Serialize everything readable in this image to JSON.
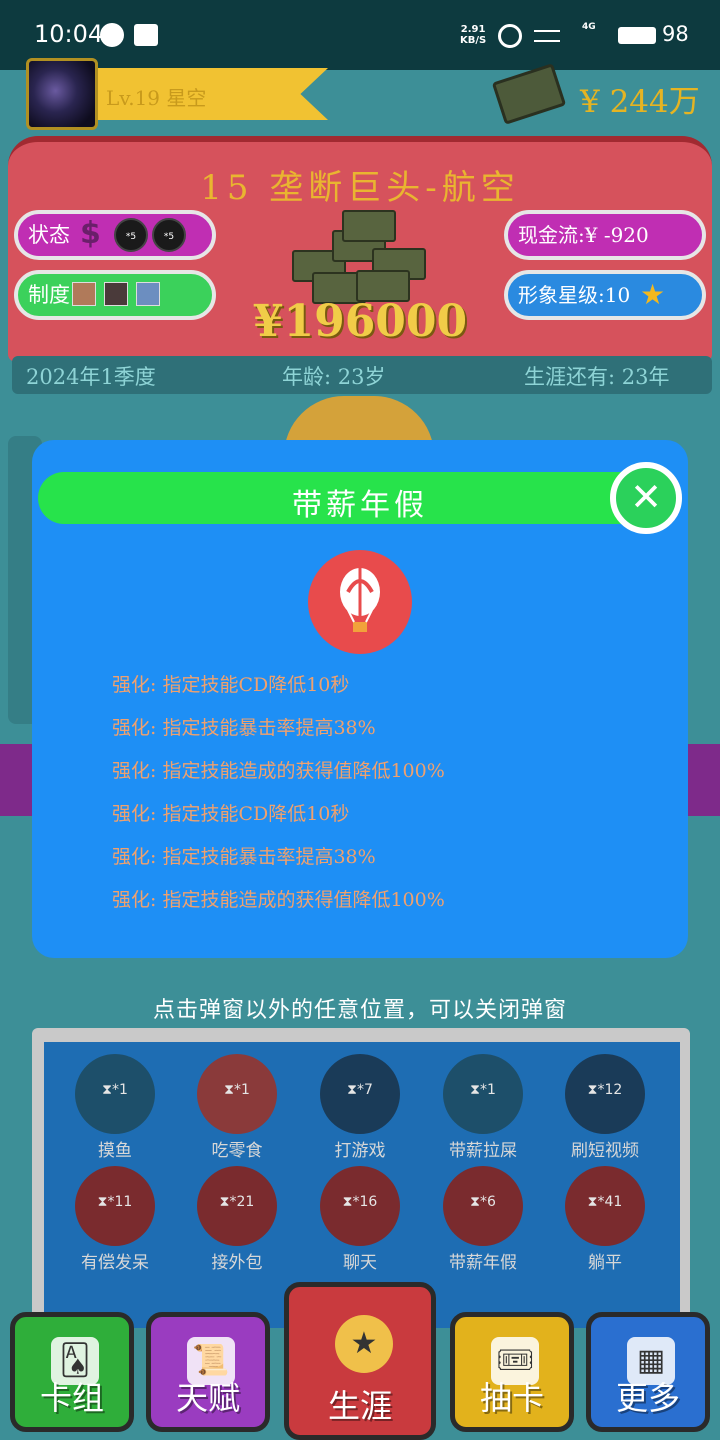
{
  "status_bar": {
    "time": "10:04",
    "speed_top": "2.91",
    "speed_bottom": "KB/S",
    "network": "4G",
    "battery": "98"
  },
  "header": {
    "level": "Lv.19 星空",
    "cash": "¥ 244万"
  },
  "company": {
    "title": "15 垄断巨头-航空",
    "status_label": "状态",
    "status_badges": [
      "*5",
      "*5"
    ],
    "system_label": "制度",
    "cash_flow": "现金流:¥ -920",
    "image_star": "形象星级:10",
    "amount": "¥196000",
    "date": "2024年1季度",
    "age": "年龄: 23岁",
    "career_left": "生涯还有: 23年"
  },
  "modal": {
    "title": "带薪年假",
    "effects": [
      "强化: 指定技能CD降低10秒",
      "强化: 指定技能暴击率提高38%",
      "强化: 指定技能造成的获得值降低100%",
      "强化: 指定技能CD降低10秒",
      "强化: 指定技能暴击率提高38%",
      "强化: 指定技能造成的获得值降低100%"
    ]
  },
  "hint": "点击弹窗以外的任意位置，可以关闭弹窗",
  "skills": [
    {
      "name": "摸鱼",
      "count": "⧗*1",
      "color": "#1d4f6a",
      "icon": "fish-icon"
    },
    {
      "name": "吃零食",
      "count": "⧗*1",
      "color": "#8a3a3a",
      "icon": "snack-icon"
    },
    {
      "name": "打游戏",
      "count": "⧗*7",
      "color": "#1a3b58",
      "icon": "gamepad-icon"
    },
    {
      "name": "带薪拉屎",
      "count": "⧗*1",
      "color": "#1d4f6a",
      "icon": "toilet-paper-icon"
    },
    {
      "name": "刷短视频",
      "count": "⧗*12",
      "color": "#1a3b58",
      "icon": "phone-icon"
    },
    {
      "name": "有偿发呆",
      "count": "⧗*11",
      "color": "#7a2b2e",
      "icon": "daydream-icon"
    },
    {
      "name": "接外包",
      "count": "⧗*21",
      "color": "#7a2b2e",
      "icon": "laptop-icon"
    },
    {
      "name": "聊天",
      "count": "⧗*16",
      "color": "#7a2b2e",
      "icon": "chat-icon"
    },
    {
      "name": "带薪年假",
      "count": "⧗*6",
      "color": "#7a2b2e",
      "icon": "balloon-icon"
    },
    {
      "name": "躺平",
      "count": "⧗*41",
      "color": "#7a2b2e",
      "icon": "lie-flat-icon"
    }
  ],
  "tabs": [
    {
      "label": "卡组",
      "color": "#2fae3a",
      "icon": "cards-icon",
      "glyph": "🂡"
    },
    {
      "label": "天赋",
      "color": "#9a3cc0",
      "icon": "scroll-icon",
      "glyph": "📜"
    },
    {
      "label": "生涯",
      "color": "#c93a3e",
      "icon": "medal-icon",
      "glyph": "★"
    },
    {
      "label": "抽卡",
      "color": "#e2b21c",
      "icon": "ticket-icon",
      "glyph": "🎟"
    },
    {
      "label": "更多",
      "color": "#2a6fd0",
      "icon": "chart-board-icon",
      "glyph": "▦"
    }
  ]
}
